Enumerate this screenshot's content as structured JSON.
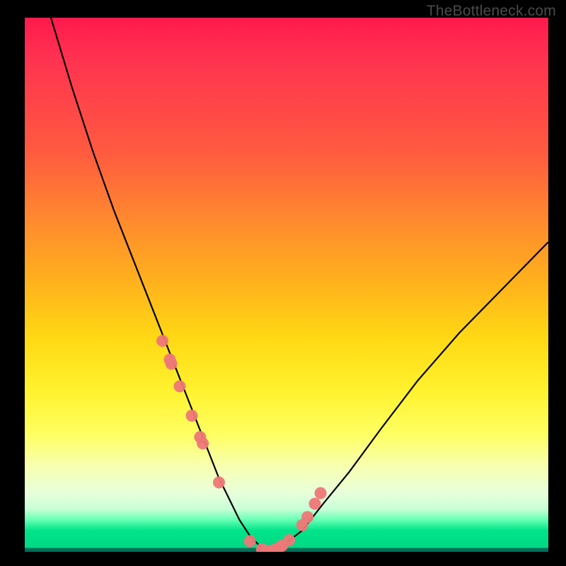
{
  "watermark": "TheBottleneck.com",
  "chart_data": {
    "type": "line",
    "title": "",
    "xlabel": "",
    "ylabel": "",
    "xlim": [
      0,
      100
    ],
    "ylim": [
      0,
      100
    ],
    "series": [
      {
        "name": "bottleneck-curve",
        "x": [
          5,
          9,
          13,
          17,
          21,
          25,
          27,
          29,
          31,
          33,
          35,
          37,
          39,
          41,
          43,
          45,
          47,
          49,
          53,
          57,
          62,
          68,
          75,
          83,
          92,
          100
        ],
        "values": [
          100,
          87,
          75,
          64,
          54,
          44,
          39,
          34,
          29,
          24,
          19,
          14,
          10,
          6,
          3,
          1,
          0,
          1,
          4,
          9,
          15,
          23,
          32,
          41,
          50,
          58
        ]
      }
    ],
    "markers": {
      "name": "highlight-dots",
      "x": [
        26.3,
        27.7,
        28.0,
        29.6,
        31.9,
        33.5,
        34.0,
        37.1,
        43.0,
        45.3,
        46.2,
        47.0,
        47.8,
        48.6,
        49.2,
        50.5,
        53.0,
        54.0,
        55.4,
        56.5
      ],
      "y": [
        39.5,
        36.0,
        35.2,
        31.0,
        25.5,
        21.5,
        20.3,
        13.0,
        2.0,
        0.5,
        0.2,
        0.2,
        0.4,
        0.8,
        1.2,
        2.2,
        5.0,
        6.5,
        9.0,
        11.0
      ]
    },
    "colors": {
      "curve": "#000000",
      "markers": "#ee7777",
      "gradient_top": "#ff1a4d",
      "gradient_bottom": "#00d884"
    }
  }
}
